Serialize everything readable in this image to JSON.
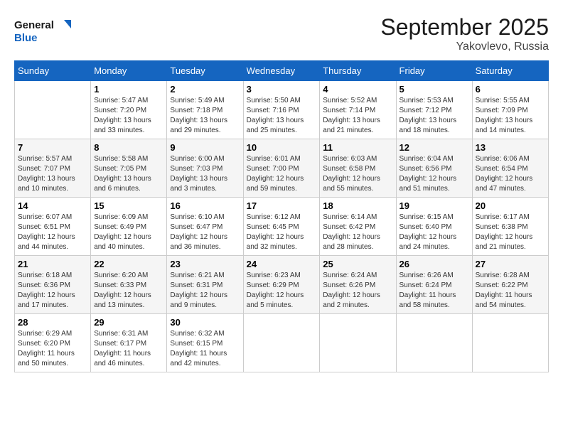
{
  "logo": {
    "general": "General",
    "blue": "Blue"
  },
  "title": "September 2025",
  "subtitle": "Yakovlevo, Russia",
  "days_of_week": [
    "Sunday",
    "Monday",
    "Tuesday",
    "Wednesday",
    "Thursday",
    "Friday",
    "Saturday"
  ],
  "weeks": [
    [
      {
        "day": "",
        "info": ""
      },
      {
        "day": "1",
        "info": "Sunrise: 5:47 AM\nSunset: 7:20 PM\nDaylight: 13 hours and 33 minutes."
      },
      {
        "day": "2",
        "info": "Sunrise: 5:49 AM\nSunset: 7:18 PM\nDaylight: 13 hours and 29 minutes."
      },
      {
        "day": "3",
        "info": "Sunrise: 5:50 AM\nSunset: 7:16 PM\nDaylight: 13 hours and 25 minutes."
      },
      {
        "day": "4",
        "info": "Sunrise: 5:52 AM\nSunset: 7:14 PM\nDaylight: 13 hours and 21 minutes."
      },
      {
        "day": "5",
        "info": "Sunrise: 5:53 AM\nSunset: 7:12 PM\nDaylight: 13 hours and 18 minutes."
      },
      {
        "day": "6",
        "info": "Sunrise: 5:55 AM\nSunset: 7:09 PM\nDaylight: 13 hours and 14 minutes."
      }
    ],
    [
      {
        "day": "7",
        "info": "Sunrise: 5:57 AM\nSunset: 7:07 PM\nDaylight: 13 hours and 10 minutes."
      },
      {
        "day": "8",
        "info": "Sunrise: 5:58 AM\nSunset: 7:05 PM\nDaylight: 13 hours and 6 minutes."
      },
      {
        "day": "9",
        "info": "Sunrise: 6:00 AM\nSunset: 7:03 PM\nDaylight: 13 hours and 3 minutes."
      },
      {
        "day": "10",
        "info": "Sunrise: 6:01 AM\nSunset: 7:00 PM\nDaylight: 12 hours and 59 minutes."
      },
      {
        "day": "11",
        "info": "Sunrise: 6:03 AM\nSunset: 6:58 PM\nDaylight: 12 hours and 55 minutes."
      },
      {
        "day": "12",
        "info": "Sunrise: 6:04 AM\nSunset: 6:56 PM\nDaylight: 12 hours and 51 minutes."
      },
      {
        "day": "13",
        "info": "Sunrise: 6:06 AM\nSunset: 6:54 PM\nDaylight: 12 hours and 47 minutes."
      }
    ],
    [
      {
        "day": "14",
        "info": "Sunrise: 6:07 AM\nSunset: 6:51 PM\nDaylight: 12 hours and 44 minutes."
      },
      {
        "day": "15",
        "info": "Sunrise: 6:09 AM\nSunset: 6:49 PM\nDaylight: 12 hours and 40 minutes."
      },
      {
        "day": "16",
        "info": "Sunrise: 6:10 AM\nSunset: 6:47 PM\nDaylight: 12 hours and 36 minutes."
      },
      {
        "day": "17",
        "info": "Sunrise: 6:12 AM\nSunset: 6:45 PM\nDaylight: 12 hours and 32 minutes."
      },
      {
        "day": "18",
        "info": "Sunrise: 6:14 AM\nSunset: 6:42 PM\nDaylight: 12 hours and 28 minutes."
      },
      {
        "day": "19",
        "info": "Sunrise: 6:15 AM\nSunset: 6:40 PM\nDaylight: 12 hours and 24 minutes."
      },
      {
        "day": "20",
        "info": "Sunrise: 6:17 AM\nSunset: 6:38 PM\nDaylight: 12 hours and 21 minutes."
      }
    ],
    [
      {
        "day": "21",
        "info": "Sunrise: 6:18 AM\nSunset: 6:36 PM\nDaylight: 12 hours and 17 minutes."
      },
      {
        "day": "22",
        "info": "Sunrise: 6:20 AM\nSunset: 6:33 PM\nDaylight: 12 hours and 13 minutes."
      },
      {
        "day": "23",
        "info": "Sunrise: 6:21 AM\nSunset: 6:31 PM\nDaylight: 12 hours and 9 minutes."
      },
      {
        "day": "24",
        "info": "Sunrise: 6:23 AM\nSunset: 6:29 PM\nDaylight: 12 hours and 5 minutes."
      },
      {
        "day": "25",
        "info": "Sunrise: 6:24 AM\nSunset: 6:26 PM\nDaylight: 12 hours and 2 minutes."
      },
      {
        "day": "26",
        "info": "Sunrise: 6:26 AM\nSunset: 6:24 PM\nDaylight: 11 hours and 58 minutes."
      },
      {
        "day": "27",
        "info": "Sunrise: 6:28 AM\nSunset: 6:22 PM\nDaylight: 11 hours and 54 minutes."
      }
    ],
    [
      {
        "day": "28",
        "info": "Sunrise: 6:29 AM\nSunset: 6:20 PM\nDaylight: 11 hours and 50 minutes."
      },
      {
        "day": "29",
        "info": "Sunrise: 6:31 AM\nSunset: 6:17 PM\nDaylight: 11 hours and 46 minutes."
      },
      {
        "day": "30",
        "info": "Sunrise: 6:32 AM\nSunset: 6:15 PM\nDaylight: 11 hours and 42 minutes."
      },
      {
        "day": "",
        "info": ""
      },
      {
        "day": "",
        "info": ""
      },
      {
        "day": "",
        "info": ""
      },
      {
        "day": "",
        "info": ""
      }
    ]
  ]
}
